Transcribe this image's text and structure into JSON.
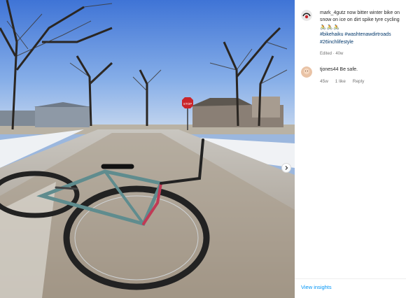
{
  "post": {
    "image_alt_summary": "",
    "caption": {
      "username": "mark_4gutz",
      "text": "now bitter winter bike on snow on ice on dirt spike tyre cycling",
      "emojis": "🚴🚴🚴",
      "hashtags": [
        "#bikehaiku",
        "#washtenawdirtroads",
        "#26inchlifestyle"
      ],
      "meta": "Edited · 40w"
    },
    "comments": [
      {
        "username": "tjones44",
        "text": "Be safe.",
        "time": "45w",
        "likes": "1 like",
        "reply": "Reply"
      }
    ],
    "footer": {
      "view_insights": "View insights"
    },
    "colors": {
      "link": "#00376b",
      "accent": "#0095f6",
      "muted": "#737373"
    }
  }
}
